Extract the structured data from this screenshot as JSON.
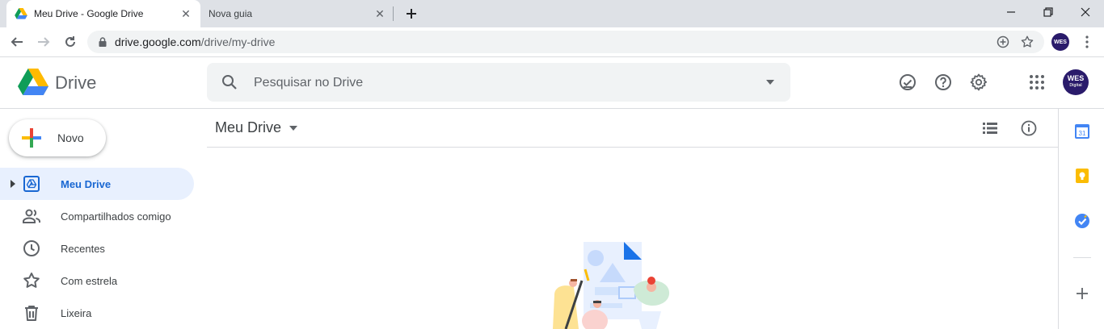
{
  "browser": {
    "tabs": [
      {
        "title": "Meu Drive - Google Drive",
        "active": true
      },
      {
        "title": "Nova guia",
        "active": false
      }
    ],
    "address": {
      "host": "drive.google.com",
      "path": "/drive/my-drive"
    },
    "profile_initials": "WES"
  },
  "header": {
    "product_name": "Drive",
    "search_placeholder": "Pesquisar no Drive",
    "avatar": {
      "main": "WES",
      "sub": "Digital"
    }
  },
  "sidebar": {
    "new_button": "Novo",
    "items": [
      {
        "label": "Meu Drive",
        "icon": "my-drive-icon",
        "active": true
      },
      {
        "label": "Compartilhados comigo",
        "icon": "people-icon",
        "active": false
      },
      {
        "label": "Recentes",
        "icon": "clock-icon",
        "active": false
      },
      {
        "label": "Com estrela",
        "icon": "star-icon",
        "active": false
      },
      {
        "label": "Lixeira",
        "icon": "trash-icon",
        "active": false
      }
    ]
  },
  "main": {
    "breadcrumb": "Meu Drive"
  },
  "side_panel": {
    "calendar_day": "31",
    "apps": [
      "calendar-icon",
      "keep-icon",
      "tasks-icon",
      "add-icon"
    ]
  },
  "colors": {
    "accent_blue": "#1967d2",
    "active_bg": "#e8f0fe",
    "tab_strip": "#dee1e6",
    "search_bg": "#f1f3f4"
  }
}
